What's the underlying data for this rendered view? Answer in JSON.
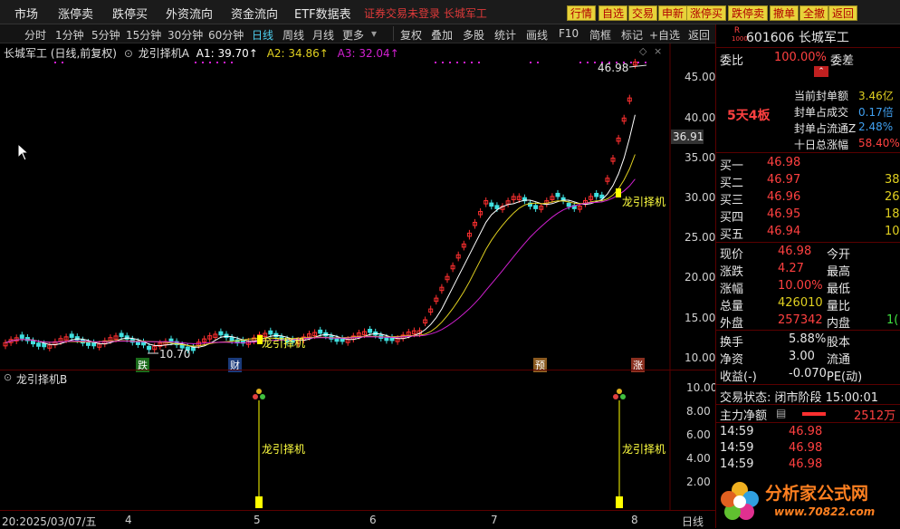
{
  "menu": {
    "items": [
      "市场",
      "涨停卖",
      "跌停买",
      "外资流向",
      "资金流向",
      "ETF数据表"
    ],
    "notice": "证券交易未登录  长城军工",
    "quick_buttons": [
      "行情",
      "自选",
      "交易",
      "申新",
      "涨停买",
      "跌停卖",
      "撤单",
      "全撤",
      "返回"
    ]
  },
  "toolbar": {
    "periods": [
      "分时",
      "1分钟",
      "5分钟",
      "15分钟",
      "30分钟",
      "60分钟",
      "日线",
      "周线",
      "月线",
      "更多"
    ],
    "active_period": "日线",
    "tools": [
      "复权",
      "叠加",
      "多股",
      "统计",
      "画线",
      "F10",
      "简框",
      "标记",
      "+自选",
      "返回"
    ]
  },
  "chart_header": {
    "title": "长城军工 (日线,前复权)",
    "indicator": "龙引择机A",
    "a1": "A1: 39.70↑",
    "a2": "A2: 34.86↑",
    "a3": "A3: 32.04↑"
  },
  "main_chart": {
    "y_ticks": [
      "45.00",
      "40.00",
      "35.00",
      "30.00",
      "25.00",
      "20.00",
      "15.00",
      "10.00"
    ],
    "current_price_tag": "36.91",
    "high_label": "46.98",
    "low_label": "10.70",
    "signal_labels": [
      "龙引择机",
      "龙引择机"
    ],
    "event_tags": [
      "跌",
      "财",
      "预",
      "涨"
    ]
  },
  "sub_chart": {
    "title": "龙引择机B",
    "y_ticks": [
      "10.00",
      "8.00",
      "6.00",
      "4.00",
      "2.00"
    ],
    "signal_label": "龙引择机"
  },
  "x_axis": {
    "start": "20:2025/03/07/五",
    "months": [
      "4",
      "5",
      "6",
      "7",
      "8"
    ],
    "period": "日线"
  },
  "stock": {
    "r_badge": "R",
    "badge_sub": "1000",
    "code_name": "601606 长城军工",
    "webi_label": "委比",
    "webi_value": "100.00%",
    "wecha_label": "委差",
    "streak": "5天4板",
    "seal": [
      {
        "label": "当前封单额",
        "value": "3.46亿"
      },
      {
        "label": "封单占成交",
        "value": "0.17倍"
      },
      {
        "label": "封单占流通Z",
        "value": "2.48%"
      },
      {
        "label": "十日总涨幅",
        "value": "58.40%"
      }
    ],
    "bids": [
      {
        "label": "买一",
        "price": "46.98",
        "vol": ""
      },
      {
        "label": "买二",
        "price": "46.97",
        "vol": "38"
      },
      {
        "label": "买三",
        "price": "46.96",
        "vol": "26"
      },
      {
        "label": "买四",
        "price": "46.95",
        "vol": "18"
      },
      {
        "label": "买五",
        "price": "46.94",
        "vol": "10"
      }
    ],
    "quotes": [
      {
        "l1": "现价",
        "v1": "46.98",
        "l2": "今开",
        "v2": ""
      },
      {
        "l1": "涨跌",
        "v1": "4.27",
        "l2": "最高",
        "v2": ""
      },
      {
        "l1": "涨幅",
        "v1": "10.00%",
        "l2": "最低",
        "v2": ""
      },
      {
        "l1": "总量",
        "v1": "426010",
        "l2": "量比",
        "v2": ""
      },
      {
        "l1": "外盘",
        "v1": "257342",
        "l2": "内盘",
        "v2": "1("
      }
    ],
    "fundamentals": [
      {
        "l1": "换手",
        "v1": "5.88%",
        "l2": "股本"
      },
      {
        "l1": "净资",
        "v1": "3.00",
        "l2": "流通"
      },
      {
        "l1": "收益(-)",
        "v1": "-0.070",
        "l2": "PE(动)"
      }
    ],
    "trade_status": "交易状态: 闭市阶段 15:00:01",
    "main_flow_label": "主力净额",
    "main_flow_value": "2512万",
    "ticks": [
      {
        "time": "14:59",
        "price": "46.98"
      },
      {
        "time": "14:59",
        "price": "46.98"
      },
      {
        "time": "14:59",
        "price": "46.98"
      }
    ]
  },
  "watermark": {
    "text": "分析家公式网",
    "url": "www.70822.com"
  },
  "colors": {
    "up": "#ff3030",
    "down": "#40e0e0",
    "ma1": "#ffffff",
    "ma2": "#e0d020",
    "ma3": "#d020d0",
    "signal": "#ffff00"
  }
}
